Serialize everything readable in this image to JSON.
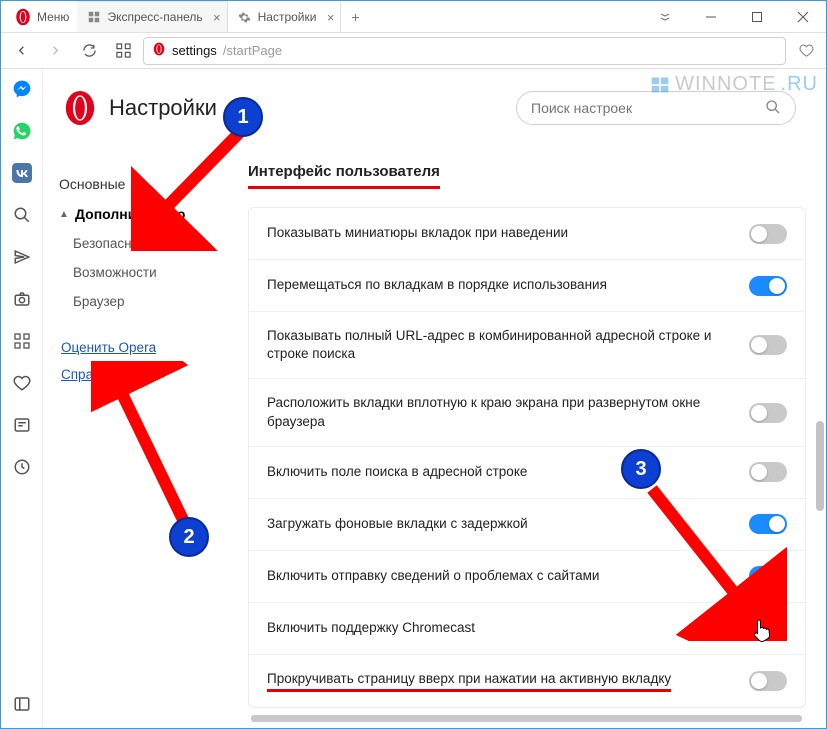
{
  "menu_label": "Меню",
  "tabs": [
    {
      "label": "Экспресс-панель",
      "active": false
    },
    {
      "label": "Настройки",
      "active": true
    }
  ],
  "address": {
    "dark": "settings",
    "light": "/startPage"
  },
  "page_title": "Настройки",
  "search": {
    "placeholder": "Поиск настроек"
  },
  "sidebar": {
    "basic": "Основные",
    "advanced": "Дополнительно",
    "security": "Безопасность",
    "features": "Возможности",
    "browser": "Браузер",
    "rate": "Оценить Opera",
    "help": "Справка Opera"
  },
  "section_title": "Интерфейс пользователя",
  "settings": [
    {
      "label": "Показывать миниатюры вкладок при наведении",
      "on": false
    },
    {
      "label": "Перемещаться по вкладкам в порядке использования",
      "on": true
    },
    {
      "label": "Показывать полный URL-адрес в комбинированной адресной строке и строке поиска",
      "on": false
    },
    {
      "label": "Расположить вкладки вплотную к краю экрана при развернутом окне браузера",
      "on": false
    },
    {
      "label": "Включить поле поиска в адресной строке",
      "on": false
    },
    {
      "label": "Загружать фоновые вкладки с задержкой",
      "on": true
    },
    {
      "label": "Включить отправку сведений о проблемах с сайтами",
      "on": true
    },
    {
      "label": "Включить поддержку Chromecast",
      "on": false
    },
    {
      "label": "Прокручивать страницу вверх при нажатии на активную вкладку",
      "on": false
    }
  ],
  "annotations": {
    "1": "1",
    "2": "2",
    "3": "3"
  },
  "watermark": {
    "pre": "WINNOTE",
    "suf": ".RU"
  }
}
